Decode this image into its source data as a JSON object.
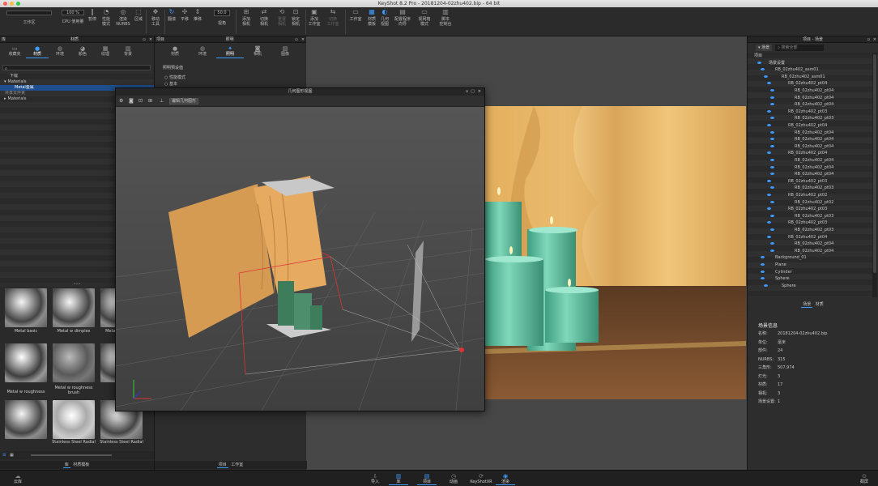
{
  "window": {
    "title": "KeyShot 8.2 Pro  -  20181204-02zhu402.bip  -  64 bit"
  },
  "toolbar": {
    "workspace": "工作区",
    "cpu": "CPU 使用量",
    "cpu_value": "100 %",
    "pause": "暂停",
    "perf_mode": "性能\n模式",
    "render_nurbs": "渲染\nNURBS",
    "region": "区域",
    "move_tool": "移动\n工具",
    "tumble": "翻滚",
    "pan": "平移",
    "dolly": "推移",
    "fov": "视角",
    "fov_value": "50.0",
    "add_camera": "添加\n相机",
    "switch_camera": "切换\n相机",
    "reset_camera": "重置\n相机",
    "lock_camera": "锁定\n相机",
    "add_studio": "添加\n工作室",
    "switch_studio": "切换\n工作室",
    "studio": "工作室",
    "mat_template": "材质\n模板",
    "geo_view": "几何\n视图",
    "config_wizard": "配置程序\n向导",
    "viewport_mode": "视网格\n模式",
    "script_console": "脚本\n控制台"
  },
  "library": {
    "title": "库",
    "materials_header": "材质",
    "tabs": [
      "收藏夹",
      "材质",
      "环境",
      "颜色",
      "纹理",
      "背景"
    ],
    "tree": [
      "下载",
      "Materials",
      "Metal金属",
      "共享文件夹",
      "Materials"
    ],
    "thumbs": [
      "Metal basic",
      "Metal w dimples",
      "Metal",
      "Metal w roughness",
      "Metal w roughness\nbrush",
      "",
      "Stainless Steel Radial",
      "Stainless Steel Radial",
      ""
    ],
    "footer": {
      "lib": "库",
      "mat_template": "材质模板"
    }
  },
  "project": {
    "title": "项目",
    "lighting_header": "照明",
    "tabs": [
      "材质",
      "环境",
      "照明",
      "相机",
      "图像"
    ],
    "preset_label": "照明预设值",
    "options": [
      "性能模式",
      "基本"
    ],
    "footer": {
      "project": "项目",
      "studio": "工作室"
    }
  },
  "geometry_view": {
    "title": "几何图形视图",
    "edit_button": "编辑几何图形"
  },
  "scene_tree": {
    "title": "项目 - 场景",
    "tabs": [
      "场景",
      "搜索全部"
    ],
    "items": [
      {
        "label": "项目",
        "indent": 0
      },
      {
        "label": "场景设置",
        "indent": 1
      },
      {
        "label": "RB_02zhu402_asm01",
        "indent": 2
      },
      {
        "label": "RB_02zhu402_asm01",
        "indent": 3
      },
      {
        "label": "RB_02zhu402_pt04",
        "indent": 4
      },
      {
        "label": "RB_02zhu402_pt04",
        "indent": 5
      },
      {
        "label": "RB_02zhu402_pt04",
        "indent": 5
      },
      {
        "label": "RB_02zhu402_pt04",
        "indent": 5
      },
      {
        "label": "RB_02zhu402_pt03",
        "indent": 4
      },
      {
        "label": "RB_02zhu402_pt03",
        "indent": 5
      },
      {
        "label": "RB_02zhu402_pt04",
        "indent": 4
      },
      {
        "label": "RB_02zhu402_pt04",
        "indent": 5
      },
      {
        "label": "RB_02zhu402_pt04",
        "indent": 5
      },
      {
        "label": "RB_02zhu402_pt04",
        "indent": 5
      },
      {
        "label": "RB_02zhu402_pt04",
        "indent": 4
      },
      {
        "label": "RB_02zhu402_pt04",
        "indent": 5
      },
      {
        "label": "RB_02zhu402_pt04",
        "indent": 5
      },
      {
        "label": "RB_02zhu402_pt04",
        "indent": 5
      },
      {
        "label": "RB_02zhu402_pt03",
        "indent": 4
      },
      {
        "label": "RB_02zhu402_pt03",
        "indent": 5
      },
      {
        "label": "RB_02zhu402_pt02",
        "indent": 4
      },
      {
        "label": "RB_02zhu402_pt02",
        "indent": 5
      },
      {
        "label": "RB_02zhu402_pt03",
        "indent": 4
      },
      {
        "label": "RB_02zhu402_pt03",
        "indent": 5
      },
      {
        "label": "RB_02zhu402_pt03",
        "indent": 4
      },
      {
        "label": "RB_02zhu402_pt03",
        "indent": 5
      },
      {
        "label": "RB_02zhu402_pt04",
        "indent": 4
      },
      {
        "label": "RB_02zhu402_pt04",
        "indent": 5
      },
      {
        "label": "RB_02zhu402_pt04",
        "indent": 5
      },
      {
        "label": "Background_01",
        "indent": 2
      },
      {
        "label": "Plane",
        "indent": 2
      },
      {
        "label": "Cylinder",
        "indent": 2
      },
      {
        "label": "Sphere",
        "indent": 2
      },
      {
        "label": "Sphere",
        "indent": 3
      }
    ],
    "bottom_tabs": [
      "场景",
      "材质"
    ]
  },
  "scene_info": {
    "title": "场景信息",
    "rows": [
      {
        "k": "名称:",
        "v": "20181204-02zhu402.bip"
      },
      {
        "k": "单位:",
        "v": "毫米"
      },
      {
        "k": "部件:",
        "v": "24"
      },
      {
        "k": "NURBS:",
        "v": "315"
      },
      {
        "k": "三角形:",
        "v": "507,974"
      },
      {
        "k": "灯光:",
        "v": "3"
      },
      {
        "k": "材质:",
        "v": "17"
      },
      {
        "k": "相机:",
        "v": "3"
      },
      {
        "k": "场景设置:",
        "v": "1"
      }
    ]
  },
  "bottombar": {
    "cloud": "云库",
    "import": "导入",
    "library": "库",
    "project": "项目",
    "animation": "动画",
    "keyshotxr": "KeyShotXR",
    "render": "渲染",
    "screenshot": "截屏"
  },
  "colors": {
    "accent": "#3d9bff",
    "panel": "#2d2d2d",
    "candle": "#6fcaa8",
    "curtain": "#e8b86a"
  }
}
